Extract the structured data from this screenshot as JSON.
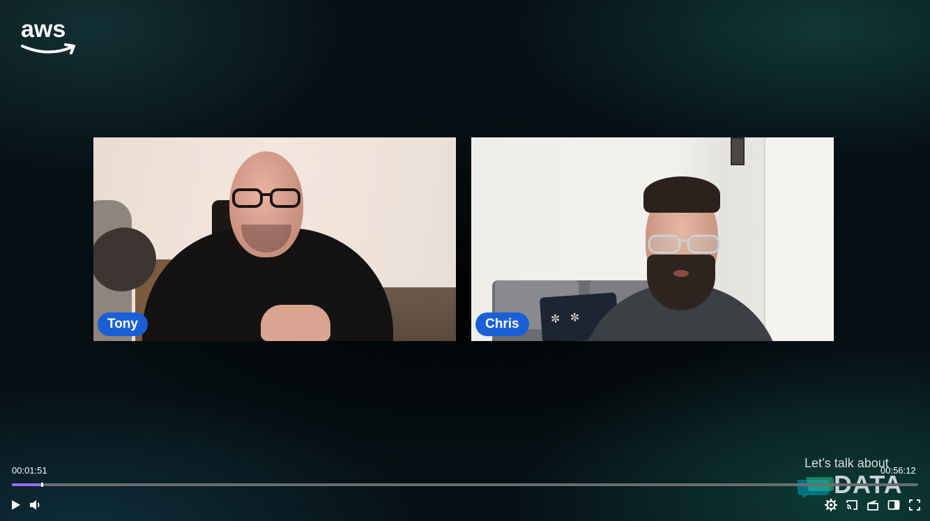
{
  "branding": {
    "logo_text": "aws"
  },
  "participants": [
    {
      "name": "Tony"
    },
    {
      "name": "Chris"
    }
  ],
  "player": {
    "current_time": "00:01:51",
    "total_time": "00:56:12",
    "progress": 0.033,
    "accent_color": "#9b6cf0"
  },
  "watermark": {
    "tagline": "Let’s talk about",
    "title": "DATA"
  },
  "controls": {
    "icons": [
      "play-icon",
      "volume-icon",
      "settings-icon",
      "cast-icon",
      "chapters-icon",
      "sidebar-icon",
      "fullscreen-icon"
    ]
  },
  "colors": {
    "name_tag": "#1a5fd6",
    "background": "#061014"
  }
}
